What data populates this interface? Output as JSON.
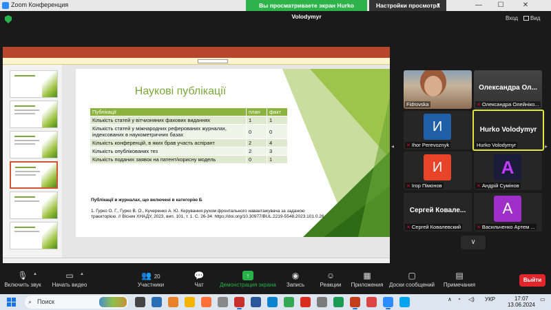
{
  "window": {
    "title": "Zoom Конференция",
    "share_banner": "Вы просматриваете экран Hurko Volodymyr",
    "view_settings": "Настройки просмотра",
    "exit_label": "Вход",
    "view_label": "Вид"
  },
  "slide": {
    "title": "Наукові публікації",
    "table": {
      "headers": [
        "Публікації",
        "план",
        "факт"
      ],
      "rows": [
        [
          "Кількість статей у вітчизняних фахових виданнях",
          "1",
          "1"
        ],
        [
          "Кількість статей у міжнародних реферованих журналах, індексованих в наукометричних базах",
          "0",
          "0"
        ],
        [
          "Кількість конференцій, в яких брав участь аспірант",
          "2",
          "4"
        ],
        [
          "Кількість опублікованих тез",
          "2",
          "3"
        ],
        [
          "Кількість поданих заявок на патент/корисну модель",
          "0",
          "1"
        ]
      ]
    },
    "category_heading": "Публікації в журналах, що включені в категорію Б",
    "reference": "1. Гурко О. Г., Гурко В. О., Кучеренко А. Ю. Керування рухом фронтального навантажувача за заданою траєкторією. // Вісник ХНАДУ, 2023, вип. 101, т. 1. С. 26-34. https://doi.org/10.30977/BUL.2219-5548.2023.101.0.26"
  },
  "participants": [
    {
      "name": "Fidrovska",
      "display": "",
      "avatar": "photo",
      "muted": false
    },
    {
      "name": "Олександра Олейніко...",
      "display": "Олександра Ол...",
      "avatar": "name",
      "muted": true
    },
    {
      "name": "Ihor Perevoznyk",
      "display": "",
      "avatar": "И",
      "muted": true
    },
    {
      "name": "Hurko Volodymyr",
      "display": "Hurko Volodymyr",
      "avatar": "name",
      "muted": false,
      "active": true
    },
    {
      "name": "Ігор Пімонов",
      "display": "",
      "avatar": "И",
      "muted": true
    },
    {
      "name": "Андрій Сумінов",
      "display": "",
      "avatar": "A",
      "muted": true
    },
    {
      "name": "Сергей Ковалевский",
      "display": "Сергей Ковале...",
      "avatar": "name",
      "muted": true
    },
    {
      "name": "Васильченко Артем ...",
      "display": "",
      "avatar": "A",
      "muted": true
    }
  ],
  "toolbar": {
    "audio": "Включить звук",
    "video": "Начать видео",
    "participants": "Участники",
    "participants_count": "20",
    "chat": "Чат",
    "share": "Демонстрация экрана",
    "record": "Запись",
    "reactions": "Реакции",
    "apps": "Приложения",
    "whiteboards": "Доски сообщений",
    "notes": "Примечания",
    "leave": "Выйти"
  },
  "taskbar": {
    "search_placeholder": "Поиск",
    "language": "УКР",
    "time": "17:07",
    "date": "13.06.2024"
  },
  "colors": {
    "slide_accent": "#7aa63a",
    "table_header": "#8bb33e",
    "share_green": "#2db34a",
    "leave_red": "#e0262a",
    "active_border": "#e6e93a"
  }
}
